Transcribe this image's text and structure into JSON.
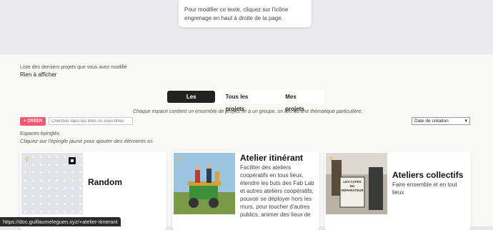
{
  "tip": {
    "text": "Pour modifier ce texte, cliquez sur l'icône engrenage en haut à droite de la page."
  },
  "recent": {
    "label": "Liste des derniers projets que vous avez modifié",
    "empty": "Rien à afficher"
  },
  "tabs": [
    {
      "label": "Les espaces",
      "active": true
    },
    {
      "label": "Tous les projets",
      "active": false
    },
    {
      "label": "Mes projets",
      "active": false
    }
  ],
  "subtitle": "Chaque espace contient un ensemble de projets lié à un groupe, un lieu ou une thématique particulière.",
  "toolbar": {
    "create_label": "+ CRÉER",
    "search_placeholder": "Chercher dans les titres ou sous-titres",
    "sort_value": "Date de création"
  },
  "pinned": {
    "label": "Espaces épinglés",
    "hint": "Cliquez sur l'épingle jaune pour ajouter des éléments ici."
  },
  "cards": [
    {
      "title": "Random",
      "desc": ""
    },
    {
      "title": "Atelier itinérant",
      "desc": "Faciliter des ateliers coopératifs en tous lieux, étendre les buts des Fab Lab et autres ateliers coopératifs, pouvoir se déployer hors les murs, pour toucher d'autres publics, animer des lieux de"
    },
    {
      "title": "Ateliers collectifs",
      "desc": "Faire ensemble et en tout lieux"
    }
  ],
  "photo_sign_text": "LES CAFÉS DU RÉPARATEUR",
  "statusbar": {
    "url": "https://doc.guillaumeleguen.xyz/+atelier-itinerant"
  },
  "colors": {
    "accent_create": "#f05a6e",
    "tab_active_bg": "#222222",
    "pin": "#e5b84a"
  }
}
